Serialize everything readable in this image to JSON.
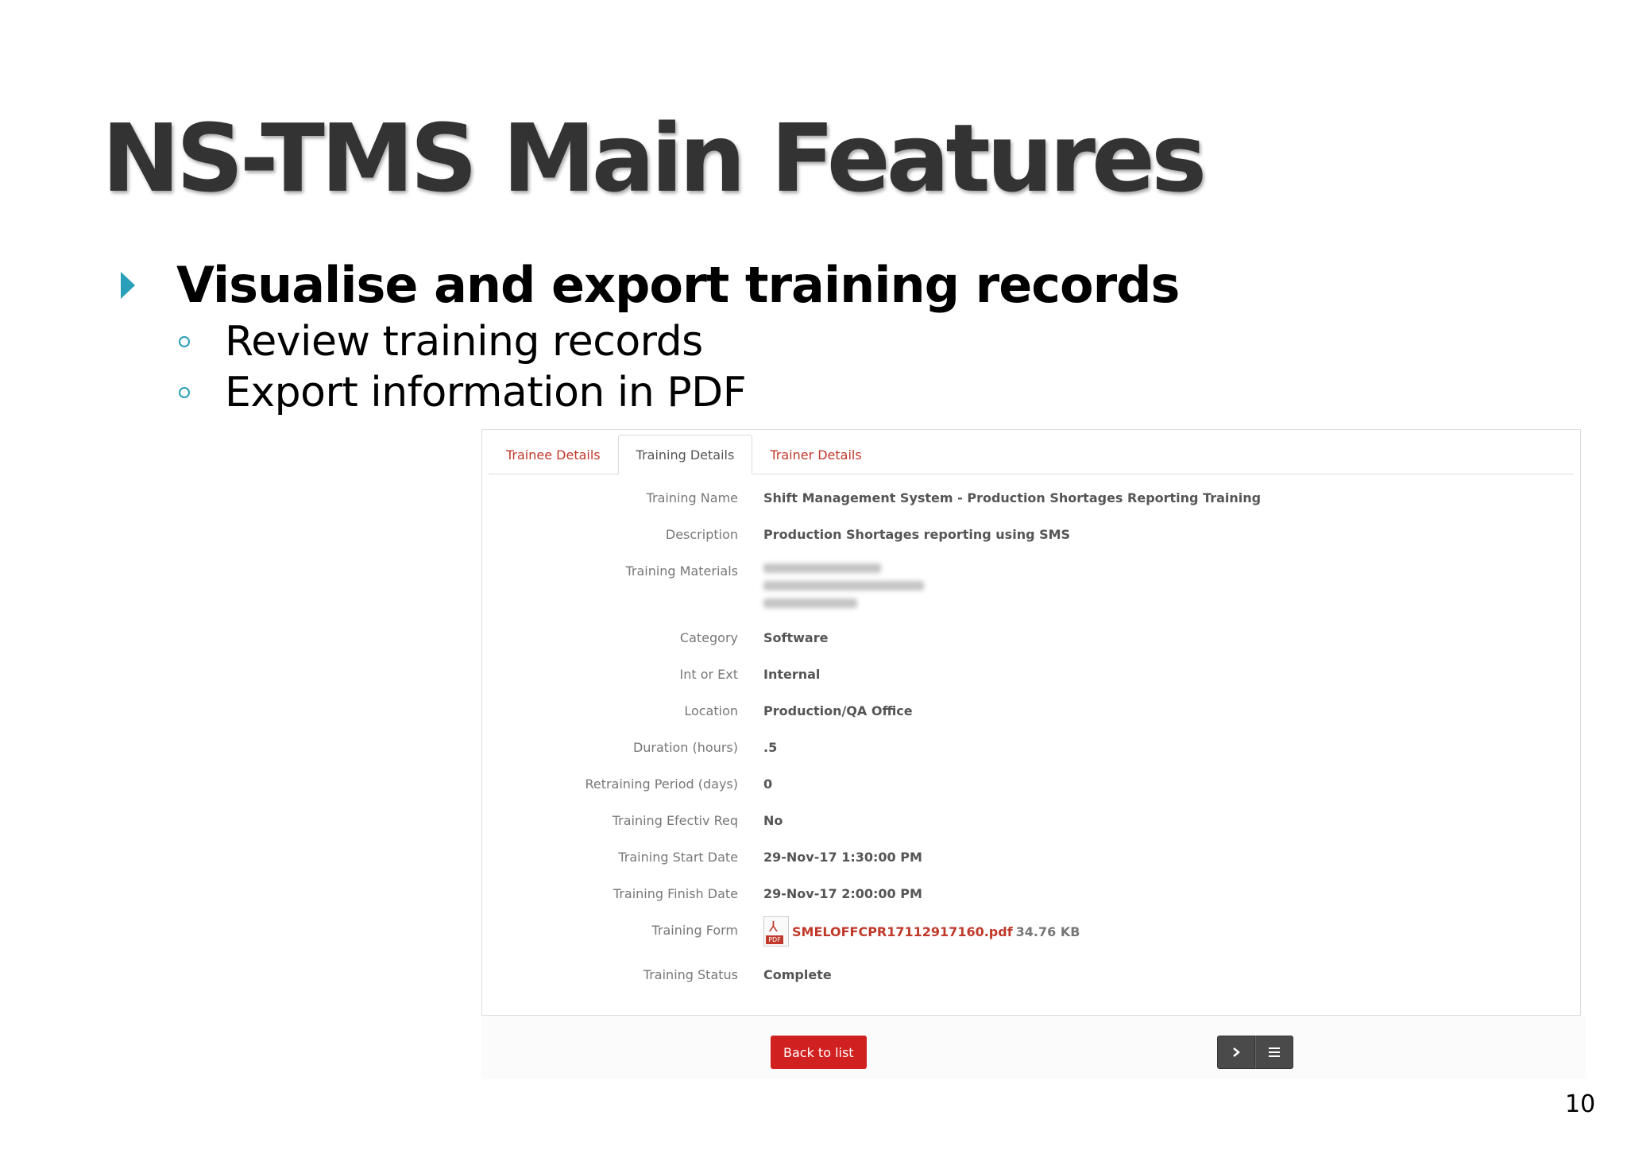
{
  "slide": {
    "title": "NS-TMS Main Features",
    "bullet": "Visualise and export training records",
    "sub_bullets": [
      "Review training records",
      "Export information in PDF"
    ],
    "page_number": "10",
    "accent_color": "#2a9fb8"
  },
  "tabs": [
    {
      "label": "Trainee Details",
      "active": false
    },
    {
      "label": "Training Details",
      "active": true
    },
    {
      "label": "Trainer Details",
      "active": false
    }
  ],
  "fields": {
    "training_name": {
      "label": "Training Name",
      "value": "Shift Management System - Production Shortages Reporting Training"
    },
    "description": {
      "label": "Description",
      "value": "Production Shortages reporting using SMS"
    },
    "training_materials": {
      "label": "Training Materials"
    },
    "category": {
      "label": "Category",
      "value": "Software"
    },
    "int_or_ext": {
      "label": "Int or Ext",
      "value": "Internal"
    },
    "location": {
      "label": "Location",
      "value": "Production/QA Office"
    },
    "duration": {
      "label": "Duration (hours)",
      "value": ".5"
    },
    "retraining": {
      "label": "Retraining Period (days)",
      "value": "0"
    },
    "effectiv": {
      "label": "Training Efectiv Req",
      "value": "No"
    },
    "start_date": {
      "label": "Training Start Date",
      "value": "29-Nov-17 1:30:00 PM"
    },
    "finish_date": {
      "label": "Training Finish Date",
      "value": "29-Nov-17 2:00:00 PM"
    },
    "training_form": {
      "label": "Training Form",
      "file_name": "SMELOFFCPR17112917160.pdf",
      "file_size": "34.76 KB",
      "icon": "pdf-file-icon",
      "icon_tag": "PDF"
    },
    "status": {
      "label": "Training Status",
      "value": "Complete"
    }
  },
  "buttons": {
    "back_label": "Back to list",
    "next_icon": "chevron-right-icon",
    "menu_icon": "list-menu-icon"
  },
  "colors": {
    "link_red": "#c0392b",
    "button_red": "#d0201f",
    "nav_dark": "#4a4a4a"
  }
}
